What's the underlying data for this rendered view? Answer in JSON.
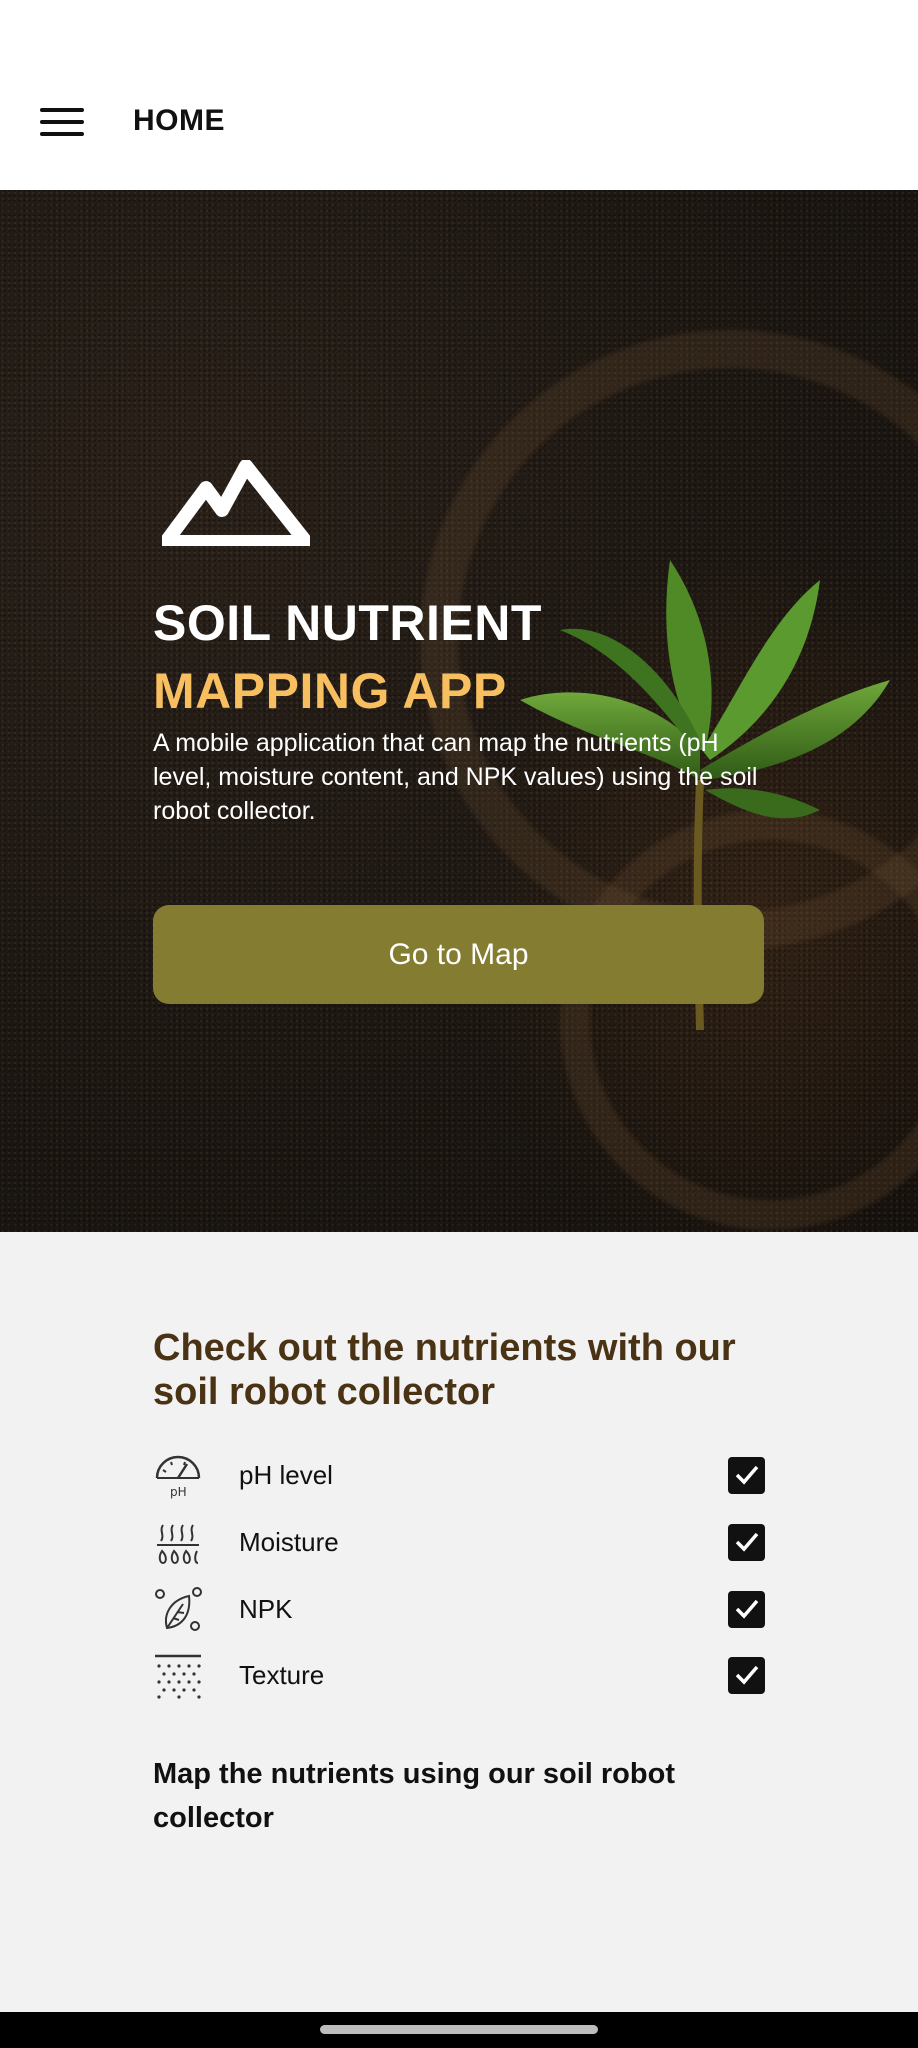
{
  "appbar": {
    "title": "HOME",
    "menu_icon": "hamburger-menu-icon"
  },
  "hero": {
    "logo_icon": "mountain-logo-icon",
    "title_line1": "SOIL NUTRIENT",
    "title_line2": "MAPPING APP",
    "description": "A mobile application that can map the nutrients (pH level, moisture content, and NPK values) using the soil robot collector.",
    "button_label": "Go to Map",
    "accent_color": "#f7bf60",
    "button_color": "#847c30"
  },
  "features": {
    "heading": "Check out the nutrients with our soil robot collector",
    "items": [
      {
        "label": "pH level",
        "icon": "ph-gauge-icon",
        "checked": true
      },
      {
        "label": "Moisture",
        "icon": "moisture-icon",
        "checked": true
      },
      {
        "label": "NPK",
        "icon": "npk-leaf-icon",
        "checked": true
      },
      {
        "label": "Texture",
        "icon": "texture-icon",
        "checked": true
      }
    ],
    "subheading": "Map the nutrients using our soil robot collector",
    "heading_color": "#4a3215"
  }
}
